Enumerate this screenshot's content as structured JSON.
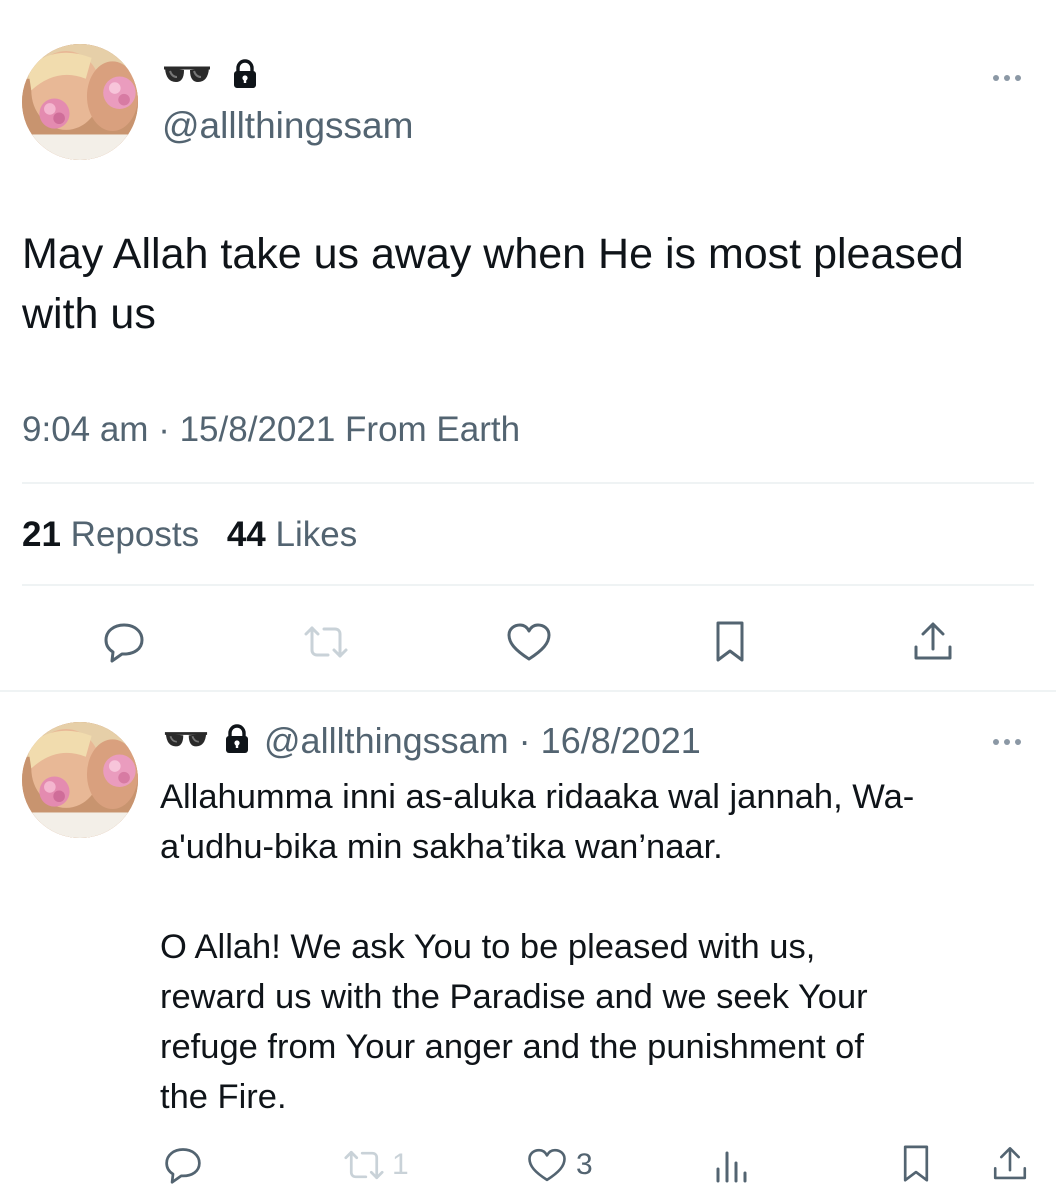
{
  "main_tweet": {
    "display_name_emoji": "glasses-emoji",
    "protected_icon": "lock-icon",
    "handle": "@alllthingssam",
    "text_line1": "May Allah take us away when He is most pleased",
    "text_line2": "with us",
    "time": "9:04 am",
    "separator": "·",
    "date": "15/8/2021",
    "source": "From Earth",
    "reposts_count": "21",
    "reposts_label": "Reposts",
    "likes_count": "44",
    "likes_label": "Likes",
    "actions": [
      "reply-icon",
      "repost-icon",
      "like-icon",
      "bookmark-icon",
      "share-icon"
    ]
  },
  "reply_tweet": {
    "display_name_emoji": "glasses-emoji",
    "protected_icon": "lock-icon",
    "handle": "@alllthingssam",
    "separator": "·",
    "date": "16/8/2021",
    "lines": [
      "Allahumma inni as-aluka ridaaka wal jannah, Wa-",
      "a'udhu-bika min sakha’tika wan’naar.",
      "O Allah! We ask You to be pleased with us,",
      "reward us with the Paradise and we seek Your",
      "refuge from Your anger and the punishment of",
      "the Fire."
    ],
    "repost_count": "1",
    "like_count": "3",
    "actions": [
      "reply-icon",
      "repost-icon",
      "like-icon",
      "views-icon",
      "bookmark-icon",
      "share-icon"
    ]
  },
  "colors": {
    "text": "#0f1419",
    "secondary": "#536471",
    "divider": "#eff3f4",
    "muted_icon": "#c9d2d8"
  }
}
